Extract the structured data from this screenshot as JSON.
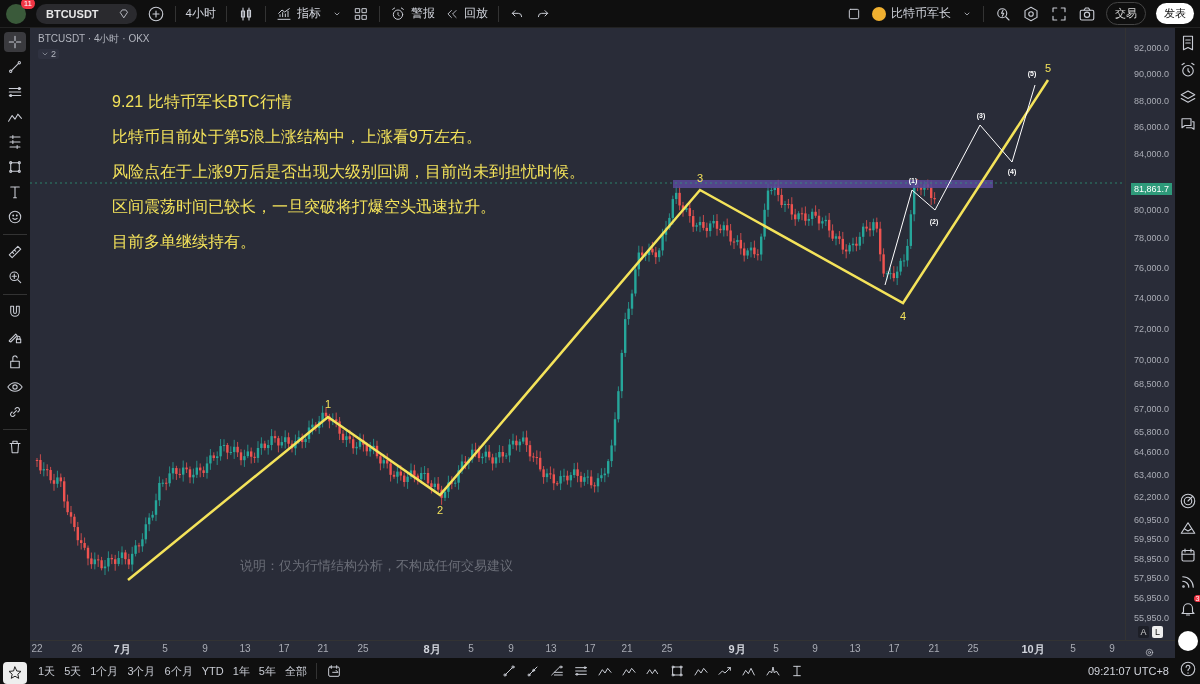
{
  "top_bar": {
    "badge": "11",
    "symbol": "BTCUSDT",
    "interval": "4小时",
    "indicators": "指标",
    "alert": "警报",
    "replay": "回放",
    "account": "比特币军长",
    "trade": "交易",
    "publish": "发表"
  },
  "left_toolbar": {
    "tools": [
      {
        "kind": "crosshair",
        "selected": true
      },
      {
        "kind": "trend-line",
        "selected": false
      },
      {
        "kind": "lines",
        "selected": false
      },
      {
        "kind": "wave",
        "selected": false
      },
      {
        "kind": "fib",
        "selected": false
      },
      {
        "kind": "rectangle",
        "selected": false
      },
      {
        "kind": "text",
        "selected": false
      },
      {
        "kind": "smiley",
        "selected": false
      },
      {
        "kind": "ruler",
        "selected": false
      },
      {
        "kind": "zoom",
        "selected": false
      },
      {
        "kind": "magnet",
        "selected": false
      },
      {
        "kind": "pencil-lock",
        "selected": false
      },
      {
        "kind": "unlock",
        "selected": false
      },
      {
        "kind": "eye",
        "selected": false
      },
      {
        "kind": "link",
        "selected": false
      },
      {
        "kind": "trash",
        "selected": false
      }
    ]
  },
  "chart": {
    "legend": "BTCUSDT · 4小时 · OKX",
    "collapsed_count": "2",
    "notes": [
      "9.21 比特币军长BTC行情",
      "比特币目前处于第5浪上涨结构中，上涨看9万左右。",
      "风险点在于上涨9万后是否出现大级别回调，目前尚未到担忧时候。",
      "区间震荡时间已较长，一旦突破将打爆空头迅速拉升。",
      "目前多单继续持有。"
    ],
    "disclaimer": "说明：仅为行情结构分析，不构成任何交易建议",
    "waves": [
      "1",
      "2",
      "3",
      "4",
      "5"
    ],
    "subwaves": [
      "(1)",
      "(2)",
      "(3)",
      "(4)",
      "(5)"
    ],
    "price_axis": [
      "92,000.0",
      "90,000.0",
      "88,000.0",
      "86,000.0",
      "84,000.0",
      "80,000.0",
      "78,000.0",
      "76,000.0",
      "74,000.0",
      "72,000.0",
      "70,000.0",
      "68,500.0",
      "67,000.0",
      "65,800.0",
      "64,600.0",
      "63,400.0",
      "62,200.0",
      "60,950.0",
      "59,950.0",
      "58,950.0",
      "57,950.0",
      "56,950.0",
      "55,950.0"
    ],
    "last_price": "81,861.7",
    "date_axis": [
      "22",
      "26",
      "7月",
      "5",
      "9",
      "13",
      "17",
      "21",
      "25",
      "8月",
      "5",
      "9",
      "13",
      "17",
      "21",
      "25",
      "9月",
      "5",
      "9",
      "13",
      "17",
      "21",
      "25",
      "10月",
      "5",
      "9"
    ],
    "scale_buttons": [
      {
        "label": "A",
        "selected": false
      },
      {
        "label": "L",
        "selected": true
      }
    ]
  },
  "bottom_bar": {
    "ranges": [
      "1天",
      "5天",
      "1个月",
      "3个月",
      "6个月",
      "YTD",
      "1年",
      "5年",
      "全部"
    ],
    "time": "09:21:07 UTC+8"
  },
  "right_sidebar": {
    "notification_count": "3"
  }
}
